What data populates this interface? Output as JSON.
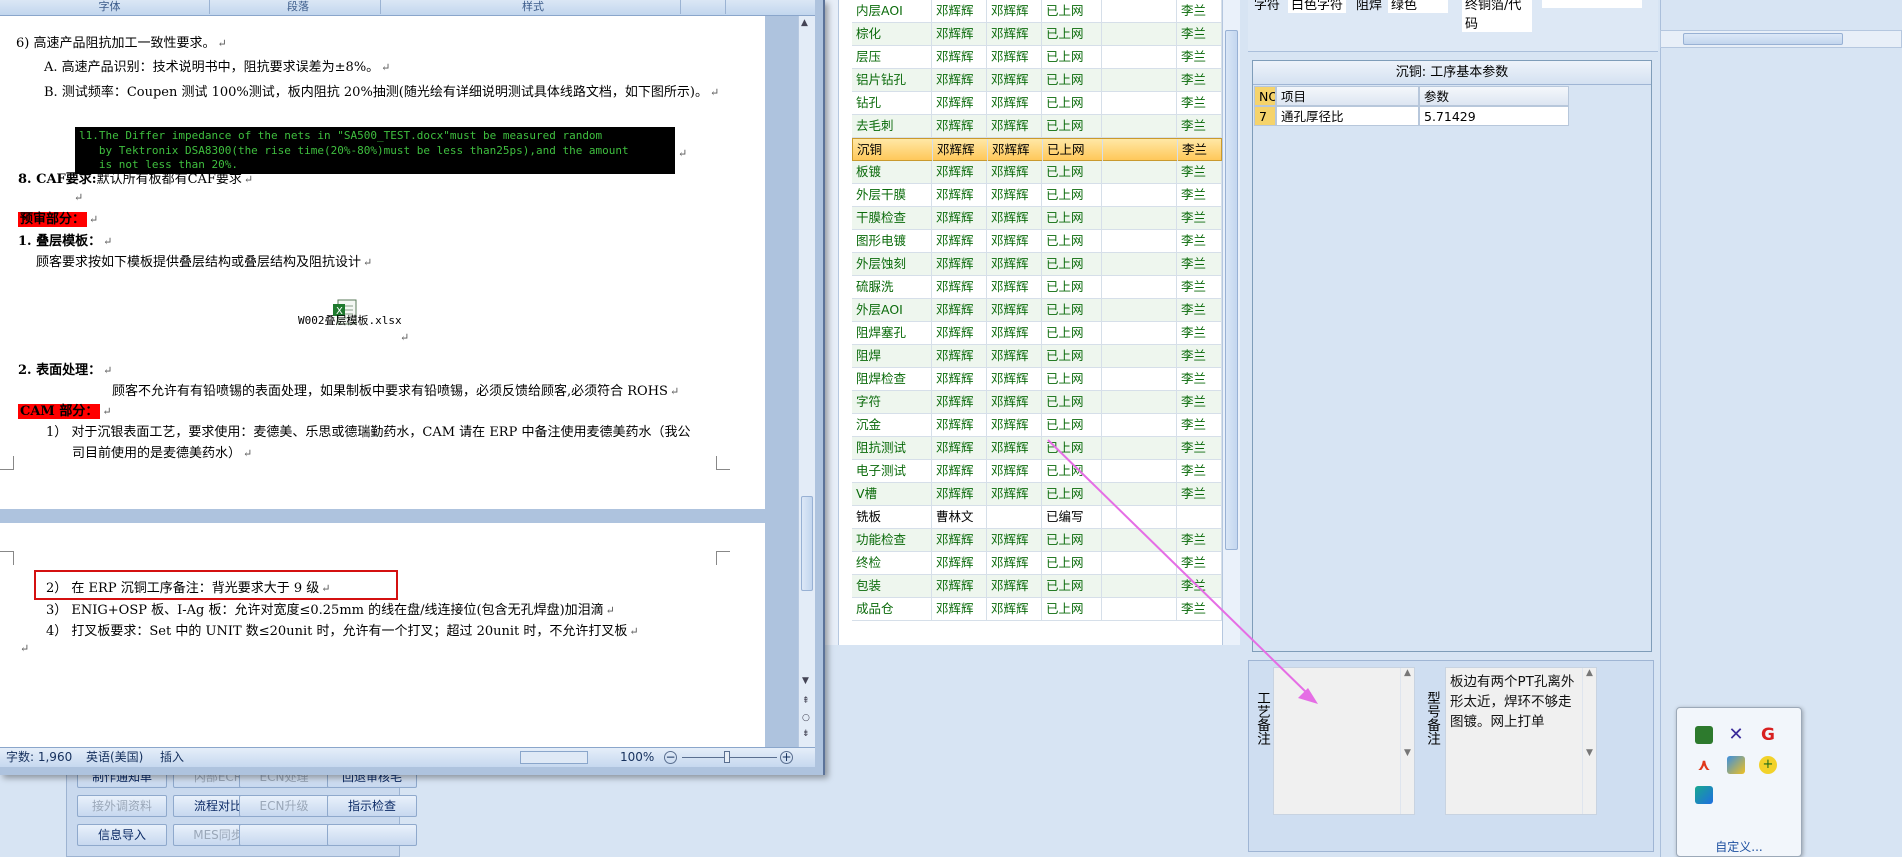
{
  "word": {
    "ribbon_groups": [
      "字体",
      "段落",
      "样式"
    ],
    "lines": {
      "p6_heading": "6) 高速产品阻抗加工一致性要求。",
      "p6_a": "A. 高速产品识别：技术说明书中，阻抗要求误差为±8%。",
      "p6_b": "B. 测试频率：Coupen 测试 100%测试，板内阻抗 20%抽测(随光绘有详细说明测试具体线路文档，如下图所示)。",
      "code": "l1.The Differ impedance of the nets in \"SA500_TEST.docx\"must be measured random\n   by Tektronix DSA8300(the rise time(20%-80%)must be less than25ps),and the amount\n   is not less than 20%.",
      "p8_label": "8. CAF要求:",
      "p8_text": "默认所有板都有CAF要求",
      "pre_review": "预审部分：",
      "s1_label": "1. 叠层模板：",
      "s1_text": "顾客要求按如下模板提供叠层结构或叠层结构及阻抗设计",
      "attachment_name": "W002叠层模板.xlsx",
      "s2_label": "2. 表面处理：",
      "s2_text": "顾客不允许有有铅喷锡的表面处理，如果制板中要求有铅喷锡，必须反馈给顾客,必须符合 ROHS",
      "cam": "CAM 部分：",
      "cam1_a": "1） 对于沉银表面工艺，要求使用：麦德美、乐思或德瑞勤药水，CAM 请在 ERP 中备注使用麦德美药水（我公",
      "cam1_b": "司目前使用的是麦德美药水）",
      "cam2": "2） 在 ERP 沉铜工序备注：背光要求大于 9 级",
      "cam3": "3） ENIG+OSP 板、I-Ag 板：允许对宽度≤0.25mm 的线在盘/线连接位(包含无孔焊盘)加泪滴",
      "cam4": "4） 打叉板要求：Set 中的 UNIT 数≤20unit 时，允许有一个打叉；超过 20unit 时，不允许打叉板"
    },
    "status": {
      "word_count": "字数: 1,960",
      "language": "英语(美国)",
      "insert_mode": "插入",
      "zoom": "100%"
    }
  },
  "erp_buttons": [
    {
      "label": "制作通知单",
      "disabled": false
    },
    {
      "label": "内部ECR",
      "disabled": true
    },
    {
      "label": "ECN处理",
      "disabled": true
    },
    {
      "label": "回退审核毛",
      "disabled": false
    },
    {
      "label": "接外调资料",
      "disabled": true
    },
    {
      "label": "流程对比",
      "disabled": false
    },
    {
      "label": "ECN升级",
      "disabled": true
    },
    {
      "label": "指示检查",
      "disabled": false
    },
    {
      "label": "信息导入",
      "disabled": false
    },
    {
      "label": "MES同步",
      "disabled": true
    },
    {
      "label": "",
      "disabled": false
    },
    {
      "label": "",
      "disabled": false
    }
  ],
  "process_grid": {
    "rows": [
      [
        "内层AOI",
        "邓辉辉",
        "邓辉辉",
        "已上网",
        "",
        "李兰"
      ],
      [
        "棕化",
        "邓辉辉",
        "邓辉辉",
        "已上网",
        "",
        "李兰"
      ],
      [
        "层压",
        "邓辉辉",
        "邓辉辉",
        "已上网",
        "",
        "李兰"
      ],
      [
        "铝片钻孔",
        "邓辉辉",
        "邓辉辉",
        "已上网",
        "",
        "李兰"
      ],
      [
        "钻孔",
        "邓辉辉",
        "邓辉辉",
        "已上网",
        "",
        "李兰"
      ],
      [
        "去毛刺",
        "邓辉辉",
        "邓辉辉",
        "已上网",
        "",
        "李兰"
      ],
      [
        "沉铜",
        "邓辉辉",
        "邓辉辉",
        "已上网",
        "",
        "李兰"
      ],
      [
        "板镀",
        "邓辉辉",
        "邓辉辉",
        "已上网",
        "",
        "李兰"
      ],
      [
        "外层干膜",
        "邓辉辉",
        "邓辉辉",
        "已上网",
        "",
        "李兰"
      ],
      [
        "干膜检查",
        "邓辉辉",
        "邓辉辉",
        "已上网",
        "",
        "李兰"
      ],
      [
        "图形电镀",
        "邓辉辉",
        "邓辉辉",
        "已上网",
        "",
        "李兰"
      ],
      [
        "外层蚀刻",
        "邓辉辉",
        "邓辉辉",
        "已上网",
        "",
        "李兰"
      ],
      [
        "硫脲洗",
        "邓辉辉",
        "邓辉辉",
        "已上网",
        "",
        "李兰"
      ],
      [
        "外层AOI",
        "邓辉辉",
        "邓辉辉",
        "已上网",
        "",
        "李兰"
      ],
      [
        "阻焊塞孔",
        "邓辉辉",
        "邓辉辉",
        "已上网",
        "",
        "李兰"
      ],
      [
        "阻焊",
        "邓辉辉",
        "邓辉辉",
        "已上网",
        "",
        "李兰"
      ],
      [
        "阻焊检查",
        "邓辉辉",
        "邓辉辉",
        "已上网",
        "",
        "李兰"
      ],
      [
        "字符",
        "邓辉辉",
        "邓辉辉",
        "已上网",
        "",
        "李兰"
      ],
      [
        "沉金",
        "邓辉辉",
        "邓辉辉",
        "已上网",
        "",
        "李兰"
      ],
      [
        "阻抗测试",
        "邓辉辉",
        "邓辉辉",
        "已上网",
        "",
        "李兰"
      ],
      [
        "电子测试",
        "邓辉辉",
        "邓辉辉",
        "已上网",
        "",
        "李兰"
      ],
      [
        "V槽",
        "邓辉辉",
        "邓辉辉",
        "已上网",
        "",
        "李兰"
      ],
      [
        "铣板",
        "曹林文",
        "",
        "已编写",
        "",
        ""
      ],
      [
        "功能检查",
        "邓辉辉",
        "邓辉辉",
        "已上网",
        "",
        "李兰"
      ],
      [
        "终检",
        "邓辉辉",
        "邓辉辉",
        "已上网",
        "",
        "李兰"
      ],
      [
        "包装",
        "邓辉辉",
        "邓辉辉",
        "已上网",
        "",
        "李兰"
      ],
      [
        "成品仓",
        "邓辉辉",
        "邓辉辉",
        "已上网",
        "",
        "李兰"
      ]
    ],
    "selected_row": 6
  },
  "top_strip": {
    "text_a": "字符",
    "text_b": "白色字符",
    "text_c": "阻焊",
    "text_d": "绿色",
    "text_e": "终铜箔/代码"
  },
  "params": {
    "title": "沉铜: 工序基本参数",
    "headers": [
      "NO",
      "项目",
      "参数"
    ],
    "rows": [
      [
        "7",
        "通孔厚径比",
        "5.71429"
      ]
    ]
  },
  "remarks": {
    "process_label": "工艺备注",
    "part_label": "型号备注",
    "part_text": "板边有两个PT孔离外形太近，焊环不够走图镀。网上打单"
  },
  "tray": {
    "customize": "自定义..."
  },
  "colors": {
    "accent_green": "#0b6b0b",
    "selection": "#ffc85a",
    "highlight_red": "#ff0000",
    "arrow": "#e56ee5"
  }
}
